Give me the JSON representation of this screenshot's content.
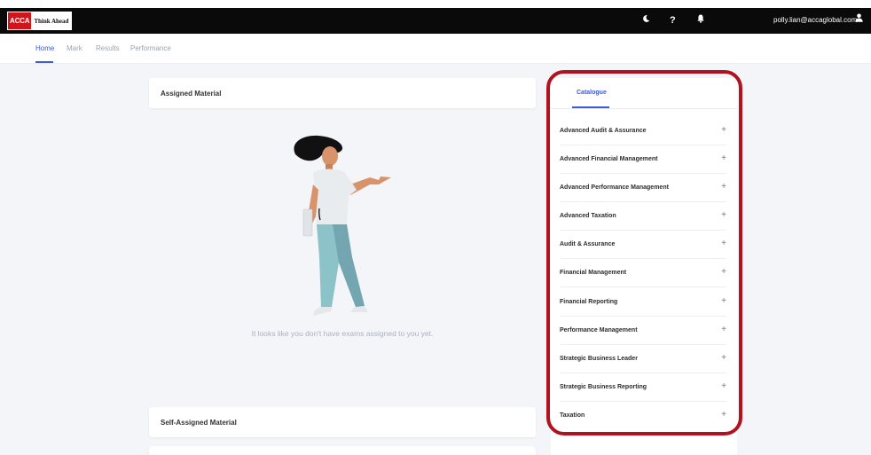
{
  "header": {
    "logo_acca": "ACCA",
    "logo_tagline": "Think Ahead",
    "user_email": "polly.lian@accaglobal.com"
  },
  "nav": {
    "tabs": [
      {
        "label": "Home"
      },
      {
        "label": "Mark"
      },
      {
        "label": "Results"
      },
      {
        "label": "Performance"
      }
    ]
  },
  "assigned": {
    "title": "Assigned Material",
    "empty_message": "It looks like you don't have exams assigned to you yet."
  },
  "self_assigned": {
    "title": "Self-Assigned Material"
  },
  "catalogue": {
    "tab_label": "Catalogue",
    "items": [
      {
        "label": "Advanced Audit & Assurance"
      },
      {
        "label": "Advanced Financial Management"
      },
      {
        "label": "Advanced Performance Management"
      },
      {
        "label": "Advanced Taxation"
      },
      {
        "label": "Audit & Assurance"
      },
      {
        "label": "Financial Management"
      },
      {
        "label": "Financial Reporting"
      },
      {
        "label": "Performance Management"
      },
      {
        "label": "Strategic Business Leader"
      },
      {
        "label": "Strategic Business Reporting"
      },
      {
        "label": "Taxation"
      }
    ],
    "expand_symbol": "+"
  },
  "colors": {
    "accent": "#3c5bd4",
    "highlight": "#b0121e",
    "brand_red": "#d3141b"
  },
  "icons": {
    "theme": "moon-icon",
    "help": "help-icon",
    "notifications": "bell-icon",
    "user": "user-icon"
  }
}
